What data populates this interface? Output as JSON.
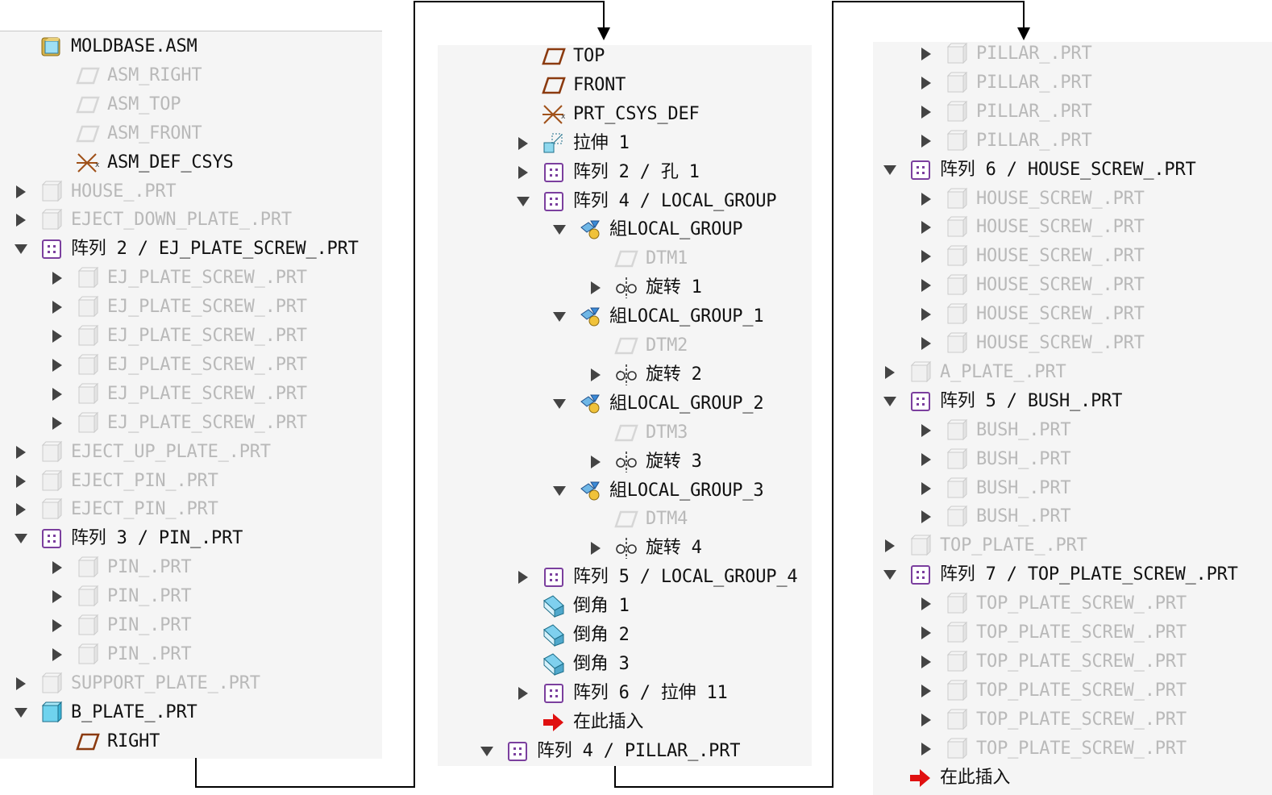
{
  "panels": [
    {
      "id": "left",
      "rows": [
        {
          "label": "MOLDBASE.ASM",
          "icon": "assembly",
          "arrow": "none",
          "indent": 0,
          "dim": false
        },
        {
          "label": "ASM_RIGHT",
          "icon": "datum-plane",
          "arrow": "none",
          "indent": 1,
          "dim": true
        },
        {
          "label": "ASM_TOP",
          "icon": "datum-plane",
          "arrow": "none",
          "indent": 1,
          "dim": true
        },
        {
          "label": "ASM_FRONT",
          "icon": "datum-plane",
          "arrow": "none",
          "indent": 1,
          "dim": true
        },
        {
          "label": "ASM_DEF_CSYS",
          "icon": "csys",
          "arrow": "none",
          "indent": 1,
          "dim": false
        },
        {
          "label": "HOUSE_.PRT",
          "icon": "part",
          "arrow": "right",
          "indent": 0,
          "dim": true
        },
        {
          "label": "EJECT_DOWN_PLATE_.PRT",
          "icon": "part",
          "arrow": "right",
          "indent": 0,
          "dim": true
        },
        {
          "label": "阵列 2 / EJ_PLATE_SCREW_.PRT",
          "icon": "pattern",
          "arrow": "down",
          "indent": 0,
          "dim": false
        },
        {
          "label": "EJ_PLATE_SCREW_.PRT",
          "icon": "part",
          "arrow": "right",
          "indent": 1,
          "dim": true
        },
        {
          "label": "EJ_PLATE_SCREW_.PRT",
          "icon": "part",
          "arrow": "right",
          "indent": 1,
          "dim": true
        },
        {
          "label": "EJ_PLATE_SCREW_.PRT",
          "icon": "part",
          "arrow": "right",
          "indent": 1,
          "dim": true
        },
        {
          "label": "EJ_PLATE_SCREW_.PRT",
          "icon": "part",
          "arrow": "right",
          "indent": 1,
          "dim": true
        },
        {
          "label": "EJ_PLATE_SCREW_.PRT",
          "icon": "part",
          "arrow": "right",
          "indent": 1,
          "dim": true
        },
        {
          "label": "EJ_PLATE_SCREW_.PRT",
          "icon": "part",
          "arrow": "right",
          "indent": 1,
          "dim": true
        },
        {
          "label": "EJECT_UP_PLATE_.PRT",
          "icon": "part",
          "arrow": "right",
          "indent": 0,
          "dim": true
        },
        {
          "label": "EJECT_PIN_.PRT",
          "icon": "part",
          "arrow": "right",
          "indent": 0,
          "dim": true
        },
        {
          "label": "EJECT_PIN_.PRT",
          "icon": "part",
          "arrow": "right",
          "indent": 0,
          "dim": true
        },
        {
          "label": "阵列 3 / PIN_.PRT",
          "icon": "pattern",
          "arrow": "down",
          "indent": 0,
          "dim": false
        },
        {
          "label": "PIN_.PRT",
          "icon": "part",
          "arrow": "right",
          "indent": 1,
          "dim": true
        },
        {
          "label": "PIN_.PRT",
          "icon": "part",
          "arrow": "right",
          "indent": 1,
          "dim": true
        },
        {
          "label": "PIN_.PRT",
          "icon": "part",
          "arrow": "right",
          "indent": 1,
          "dim": true
        },
        {
          "label": "PIN_.PRT",
          "icon": "part",
          "arrow": "right",
          "indent": 1,
          "dim": true
        },
        {
          "label": "SUPPORT_PLATE_.PRT",
          "icon": "part",
          "arrow": "right",
          "indent": 0,
          "dim": true
        },
        {
          "label": "B_PLATE_.PRT",
          "icon": "part-active",
          "arrow": "down",
          "indent": 0,
          "dim": false
        },
        {
          "label": "RIGHT",
          "icon": "datum-plane-active",
          "arrow": "none",
          "indent": 1,
          "dim": false
        }
      ]
    },
    {
      "id": "middle",
      "rows": [
        {
          "label": "TOP",
          "icon": "datum-plane-active",
          "arrow": "none",
          "indent": 1,
          "dim": false
        },
        {
          "label": "FRONT",
          "icon": "datum-plane-active",
          "arrow": "none",
          "indent": 1,
          "dim": false
        },
        {
          "label": "PRT_CSYS_DEF",
          "icon": "csys",
          "arrow": "none",
          "indent": 1,
          "dim": false
        },
        {
          "label": "拉伸 1",
          "icon": "extrude",
          "arrow": "right",
          "indent": 1,
          "dim": false
        },
        {
          "label": "阵列 2 / 孔 1",
          "icon": "pattern",
          "arrow": "right",
          "indent": 1,
          "dim": false
        },
        {
          "label": "阵列 4 / LOCAL_GROUP",
          "icon": "pattern",
          "arrow": "down",
          "indent": 1,
          "dim": false
        },
        {
          "label": "組LOCAL_GROUP",
          "icon": "group",
          "arrow": "down",
          "indent": 2,
          "dim": false
        },
        {
          "label": "DTM1",
          "icon": "datum-plane",
          "arrow": "none",
          "indent": 3,
          "dim": true
        },
        {
          "label": "旋转 1",
          "icon": "revolve",
          "arrow": "right",
          "indent": 3,
          "dim": false
        },
        {
          "label": "組LOCAL_GROUP_1",
          "icon": "group",
          "arrow": "down",
          "indent": 2,
          "dim": false
        },
        {
          "label": "DTM2",
          "icon": "datum-plane",
          "arrow": "none",
          "indent": 3,
          "dim": true
        },
        {
          "label": "旋转 2",
          "icon": "revolve",
          "arrow": "right",
          "indent": 3,
          "dim": false
        },
        {
          "label": "組LOCAL_GROUP_2",
          "icon": "group",
          "arrow": "down",
          "indent": 2,
          "dim": false
        },
        {
          "label": "DTM3",
          "icon": "datum-plane",
          "arrow": "none",
          "indent": 3,
          "dim": true
        },
        {
          "label": "旋转 3",
          "icon": "revolve",
          "arrow": "right",
          "indent": 3,
          "dim": false
        },
        {
          "label": "組LOCAL_GROUP_3",
          "icon": "group",
          "arrow": "down",
          "indent": 2,
          "dim": false
        },
        {
          "label": "DTM4",
          "icon": "datum-plane",
          "arrow": "none",
          "indent": 3,
          "dim": true
        },
        {
          "label": "旋转 4",
          "icon": "revolve",
          "arrow": "right",
          "indent": 3,
          "dim": false
        },
        {
          "label": "阵列 5 / LOCAL_GROUP_4",
          "icon": "pattern",
          "arrow": "right",
          "indent": 1,
          "dim": false
        },
        {
          "label": "倒角 1",
          "icon": "chamfer",
          "arrow": "none",
          "indent": 1,
          "dim": false
        },
        {
          "label": "倒角 2",
          "icon": "chamfer",
          "arrow": "none",
          "indent": 1,
          "dim": false
        },
        {
          "label": "倒角 3",
          "icon": "chamfer",
          "arrow": "none",
          "indent": 1,
          "dim": false
        },
        {
          "label": "阵列 6 / 拉伸 11",
          "icon": "pattern",
          "arrow": "right",
          "indent": 1,
          "dim": false
        },
        {
          "label": "在此插入",
          "icon": "insert-here",
          "arrow": "none",
          "indent": 1,
          "dim": false
        },
        {
          "label": "阵列 4 / PILLAR_.PRT",
          "icon": "pattern",
          "arrow": "down",
          "indent": 0,
          "dim": false
        }
      ]
    },
    {
      "id": "right",
      "rows": [
        {
          "label": "PILLAR_.PRT",
          "icon": "part",
          "arrow": "right",
          "indent": 1,
          "dim": true
        },
        {
          "label": "PILLAR_.PRT",
          "icon": "part",
          "arrow": "right",
          "indent": 1,
          "dim": true
        },
        {
          "label": "PILLAR_.PRT",
          "icon": "part",
          "arrow": "right",
          "indent": 1,
          "dim": true
        },
        {
          "label": "PILLAR_.PRT",
          "icon": "part",
          "arrow": "right",
          "indent": 1,
          "dim": true
        },
        {
          "label": "阵列 6 / HOUSE_SCREW_.PRT",
          "icon": "pattern",
          "arrow": "down",
          "indent": 0,
          "dim": false
        },
        {
          "label": "HOUSE_SCREW_.PRT",
          "icon": "part",
          "arrow": "right",
          "indent": 1,
          "dim": true
        },
        {
          "label": "HOUSE_SCREW_.PRT",
          "icon": "part",
          "arrow": "right",
          "indent": 1,
          "dim": true
        },
        {
          "label": "HOUSE_SCREW_.PRT",
          "icon": "part",
          "arrow": "right",
          "indent": 1,
          "dim": true
        },
        {
          "label": "HOUSE_SCREW_.PRT",
          "icon": "part",
          "arrow": "right",
          "indent": 1,
          "dim": true
        },
        {
          "label": "HOUSE_SCREW_.PRT",
          "icon": "part",
          "arrow": "right",
          "indent": 1,
          "dim": true
        },
        {
          "label": "HOUSE_SCREW_.PRT",
          "icon": "part",
          "arrow": "right",
          "indent": 1,
          "dim": true
        },
        {
          "label": "A_PLATE_.PRT",
          "icon": "part",
          "arrow": "right",
          "indent": 0,
          "dim": true
        },
        {
          "label": "阵列 5 / BUSH_.PRT",
          "icon": "pattern",
          "arrow": "down",
          "indent": 0,
          "dim": false
        },
        {
          "label": "BUSH_.PRT",
          "icon": "part",
          "arrow": "right",
          "indent": 1,
          "dim": true
        },
        {
          "label": "BUSH_.PRT",
          "icon": "part",
          "arrow": "right",
          "indent": 1,
          "dim": true
        },
        {
          "label": "BUSH_.PRT",
          "icon": "part",
          "arrow": "right",
          "indent": 1,
          "dim": true
        },
        {
          "label": "BUSH_.PRT",
          "icon": "part",
          "arrow": "right",
          "indent": 1,
          "dim": true
        },
        {
          "label": "TOP_PLATE_.PRT",
          "icon": "part",
          "arrow": "right",
          "indent": 0,
          "dim": true
        },
        {
          "label": "阵列 7 / TOP_PLATE_SCREW_.PRT",
          "icon": "pattern",
          "arrow": "down",
          "indent": 0,
          "dim": false
        },
        {
          "label": "TOP_PLATE_SCREW_.PRT",
          "icon": "part",
          "arrow": "right",
          "indent": 1,
          "dim": true
        },
        {
          "label": "TOP_PLATE_SCREW_.PRT",
          "icon": "part",
          "arrow": "right",
          "indent": 1,
          "dim": true
        },
        {
          "label": "TOP_PLATE_SCREW_.PRT",
          "icon": "part",
          "arrow": "right",
          "indent": 1,
          "dim": true
        },
        {
          "label": "TOP_PLATE_SCREW_.PRT",
          "icon": "part",
          "arrow": "right",
          "indent": 1,
          "dim": true
        },
        {
          "label": "TOP_PLATE_SCREW_.PRT",
          "icon": "part",
          "arrow": "right",
          "indent": 1,
          "dim": true
        },
        {
          "label": "TOP_PLATE_SCREW_.PRT",
          "icon": "part",
          "arrow": "right",
          "indent": 1,
          "dim": true
        },
        {
          "label": "在此插入",
          "icon": "insert-here",
          "arrow": "none",
          "indent": 0,
          "dim": false
        }
      ]
    }
  ],
  "colors": {
    "panel_bg": "#f5f5f5",
    "text": "#111111",
    "text_dim": "#b9b9b9",
    "arrow": "#444444",
    "datum_plane": "#8b3a0f",
    "pattern": "#7b3f9e",
    "insert_arrow": "#e01010",
    "connector": "#000000"
  }
}
